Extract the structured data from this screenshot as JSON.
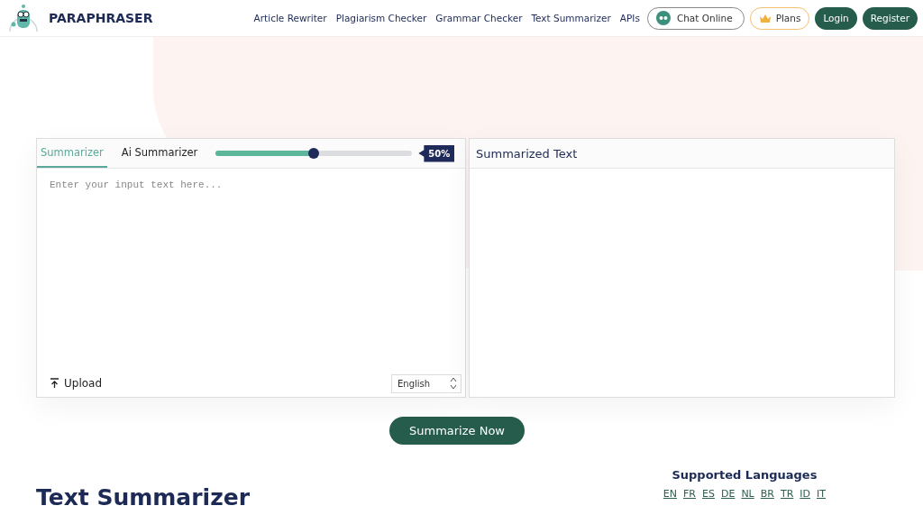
{
  "header": {
    "brand": "PARAPHRASER",
    "nav": [
      "Article Rewriter",
      "Plagiarism Checker",
      "Grammar Checker",
      "Text Summarizer",
      "APIs"
    ],
    "chat": "Chat Online",
    "plans": "Plans",
    "login": "Login",
    "register": "Register"
  },
  "input_panel": {
    "tabs": [
      {
        "label": "Summarizer",
        "selected": true
      },
      {
        "label": "Ai Summarizer",
        "selected": false
      }
    ],
    "slider": {
      "level": 0.5
    },
    "reading": "50%",
    "placeholder": "Enter your input text here...",
    "upload": "Upload",
    "language": "English"
  },
  "output_panel": {
    "title": "Summarized Text"
  },
  "action": "Summarize Now",
  "page_title": "Text Summarizer",
  "languages": {
    "title": "Supported Languages",
    "codes": [
      "EN",
      "FR",
      "ES",
      "DE",
      "NL",
      "BR",
      "TR",
      "ID",
      "IT"
    ]
  }
}
